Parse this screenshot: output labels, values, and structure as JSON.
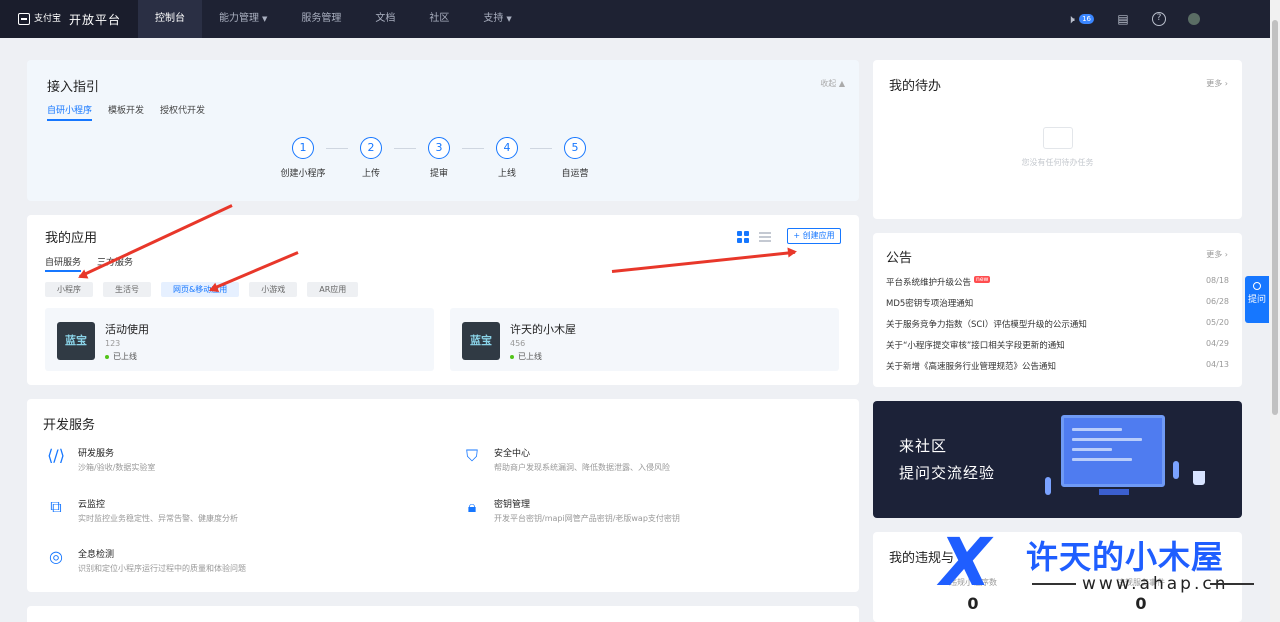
{
  "header": {
    "brand_sub": "支付宝",
    "brand_name": "开放平台",
    "nav": [
      "控制台",
      "能力管理",
      "服务管理",
      "文档",
      "社区",
      "支持"
    ],
    "notification_count": "16"
  },
  "guide": {
    "title": "接入指引",
    "collapse_label": "收起",
    "tabs": [
      "自研小程序",
      "模板开发",
      "授权代开发"
    ],
    "steps": [
      {
        "num": "1",
        "label": "创建小程序"
      },
      {
        "num": "2",
        "label": "上传"
      },
      {
        "num": "3",
        "label": "提审"
      },
      {
        "num": "4",
        "label": "上线"
      },
      {
        "num": "5",
        "label": "自运营"
      }
    ]
  },
  "apps": {
    "title": "我的应用",
    "create_label": "+ 创建应用",
    "tabs": [
      "自研服务",
      "三方服务"
    ],
    "filters": [
      "小程序",
      "生活号",
      "网页&移动应用",
      "小游戏",
      "AR应用"
    ],
    "items": [
      {
        "icon_text": "蓝宝",
        "name": "活动使用",
        "id": "123",
        "status": "已上线"
      },
      {
        "icon_text": "蓝宝",
        "name": "许天的小木屋",
        "id": "456",
        "status": "已上线"
      }
    ]
  },
  "dev": {
    "title": "开发服务",
    "services": [
      {
        "title": "研发服务",
        "desc": "沙箱/验收/数据实验室"
      },
      {
        "title": "安全中心",
        "desc": "帮助商户发现系统漏洞、降低数据泄露、入侵风险"
      },
      {
        "title": "云监控",
        "desc": "实时监控业务稳定性、异常告警、健康度分析"
      },
      {
        "title": "密钥管理",
        "desc": "开发平台密钥/mapi网管产品密钥/老版wap支付密钥"
      },
      {
        "title": "全息检测",
        "desc": "识别和定位小程序运行过程中的质量和体验问题"
      }
    ]
  },
  "todo": {
    "title": "我的待办",
    "more_label": "更多",
    "empty_text": "您没有任何待办任务"
  },
  "notice": {
    "title": "公告",
    "more_label": "更多",
    "new_tag": "new",
    "items": [
      {
        "text": "平台系统维护升级公告",
        "date": "08/18",
        "is_new": true
      },
      {
        "text": "MD5密钥专项治理通知",
        "date": "06/28",
        "is_new": false
      },
      {
        "text": "关于服务竞争力指数（SCI）评估模型升级的公示通知",
        "date": "05/20",
        "is_new": false
      },
      {
        "text": "关于“小程序提交审核”接口相关字段更新的通知",
        "date": "04/29",
        "is_new": false
      },
      {
        "text": "关于新增《高速服务行业管理规范》公告通知",
        "date": "04/13",
        "is_new": false
      }
    ]
  },
  "community": {
    "line1": "来社区",
    "line2": "提问交流经验"
  },
  "violation": {
    "title": "我的违规与",
    "items": [
      {
        "label": "违规小程序数",
        "value": "0"
      },
      {
        "label": "违规服务事件",
        "value": "0"
      }
    ]
  },
  "watermark": {
    "title": "许天的小木屋",
    "url": "www.ahap.cn"
  },
  "help": {
    "label": "提问"
  },
  "colors": {
    "accent": "#1677ff",
    "topbar": "#1e2233",
    "annotation_arrow": "#e8372a"
  }
}
